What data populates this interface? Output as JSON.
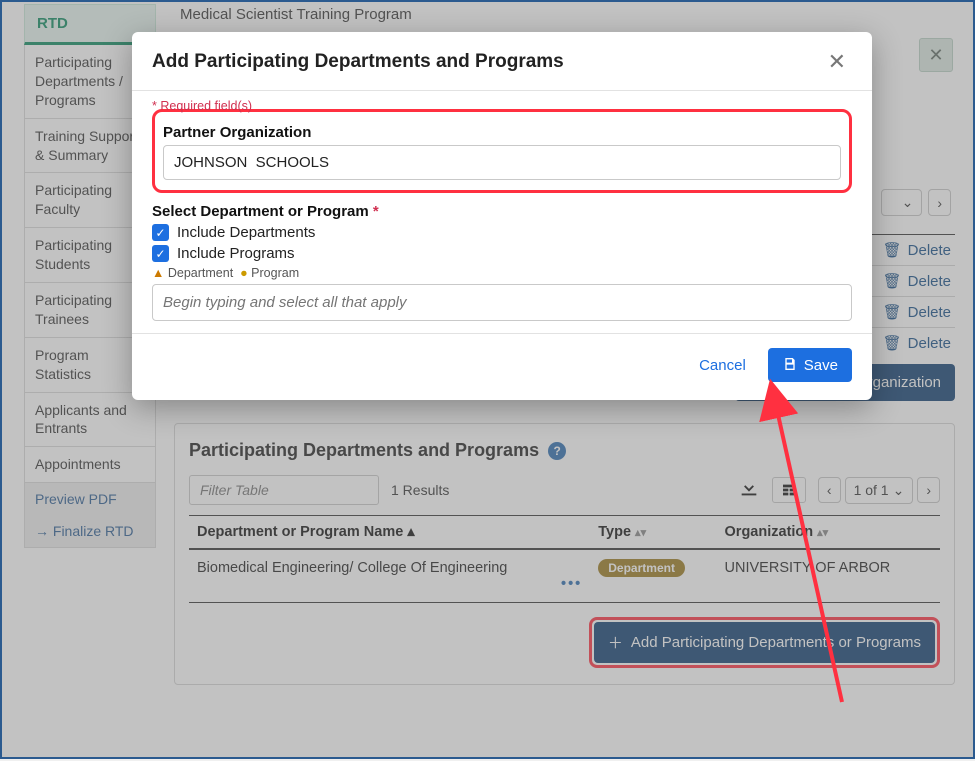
{
  "sidebar": {
    "rtd": "RTD",
    "items": [
      "Participating Departments / Programs",
      "Training Support & Summary",
      "Participating Faculty",
      "Participating Students",
      "Participating Trainees",
      "Program Statistics",
      "Applicants and Entrants",
      "Appointments"
    ],
    "preview": "Preview PDF",
    "finalize": "Finalize RTD"
  },
  "bg": {
    "program_title": "Medical Scientist Training Program",
    "pager": {
      "page_of": "of 1",
      "chev": "›"
    },
    "delete_label": "Delete",
    "add_partner": "Add Partner Organization",
    "section2": {
      "title": "Participating Departments and Programs",
      "filter_placeholder": "Filter Table",
      "results": "1 Results",
      "pager": "1 of 1",
      "col_name": "Department or Program Name",
      "col_type": "Type",
      "col_org": "Organization",
      "row": {
        "name": "Biomedical Engineering/ College Of Engineering",
        "type": "Department",
        "org": "UNIVERSITY OF ARBOR"
      },
      "add_btn": "Add Participating Departments or Programs"
    }
  },
  "modal": {
    "title": "Add Participating Departments and Programs",
    "required": "Required field(s)",
    "org_label": "Partner Organization",
    "org_value": "JOHNSON  SCHOOLS",
    "select_label": "Select Department or Program",
    "include_dept": "Include Departments",
    "include_prog": "Include Programs",
    "legend_dept": "Department",
    "legend_prog": "Program",
    "search_placeholder": "Begin typing and select all that apply",
    "cancel": "Cancel",
    "save": "Save"
  }
}
